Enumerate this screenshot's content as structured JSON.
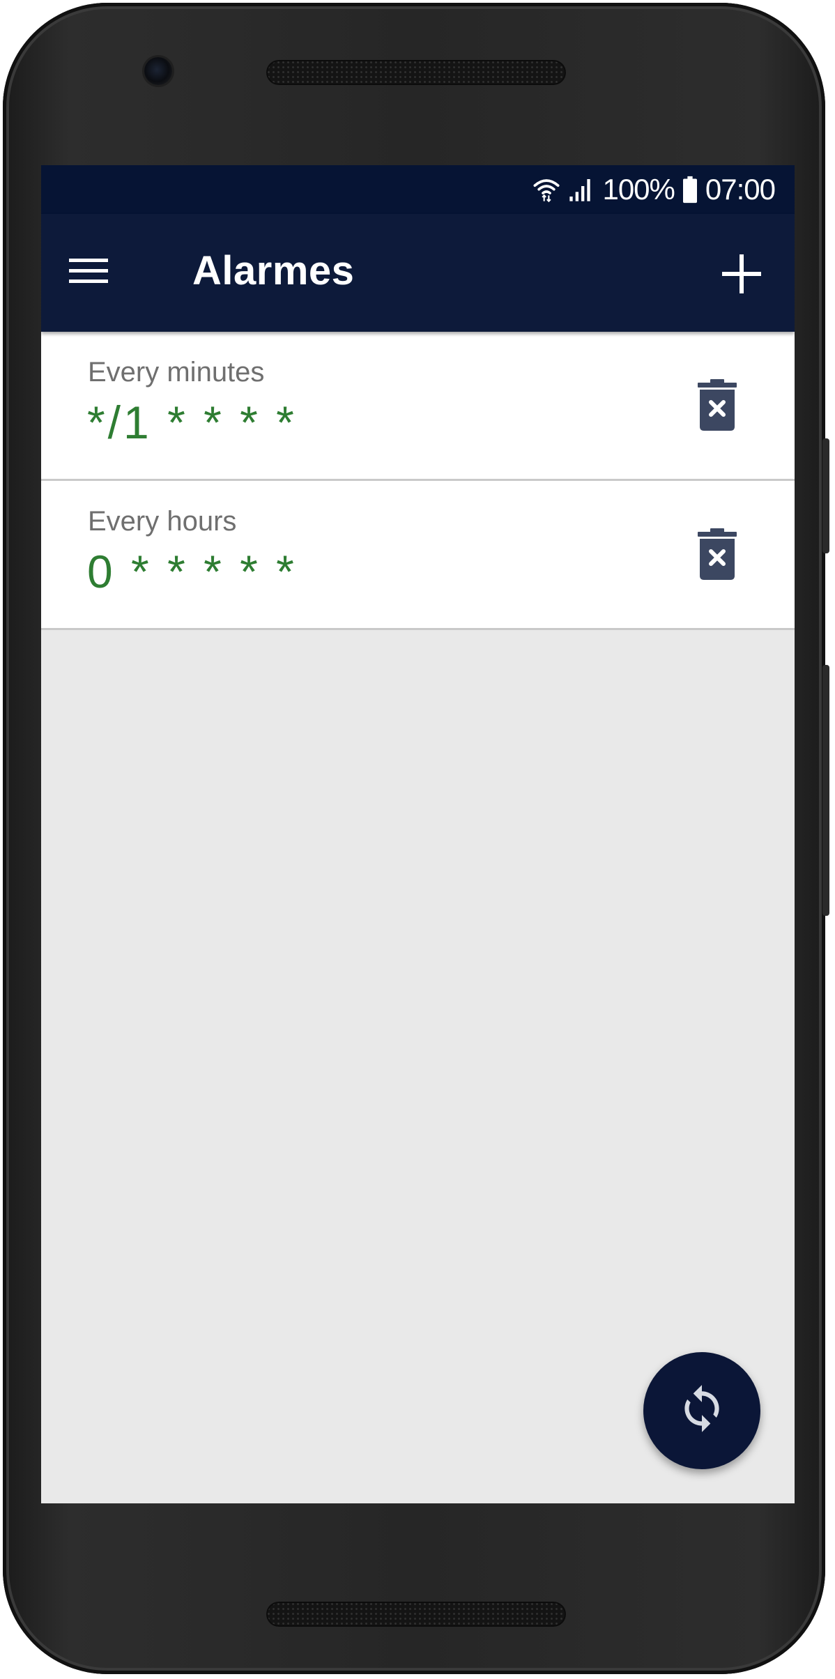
{
  "status_bar": {
    "battery": "100%",
    "time": "07:00",
    "icons": [
      "wifi-icon",
      "signal-icon",
      "battery-icon"
    ]
  },
  "app_bar": {
    "title": "Alarmes",
    "menu_icon": "hamburger-menu-icon",
    "add_icon": "plus-icon"
  },
  "alarms": [
    {
      "label": "Every minutes",
      "cron": "*/1 * * * *",
      "delete_icon": "trash-x-icon"
    },
    {
      "label": "Every hours",
      "cron": "0 * * * * *",
      "delete_icon": "trash-x-icon"
    }
  ],
  "fab": {
    "icon": "sync-icon"
  },
  "colors": {
    "status_bar": "#061434",
    "app_bar": "#0d1a3a",
    "cron_text": "#2e7d32",
    "label_text": "#6f6f6f",
    "delete_icon": "#3c4761",
    "fab": "#0b1637",
    "background": "#e9e9e9"
  }
}
